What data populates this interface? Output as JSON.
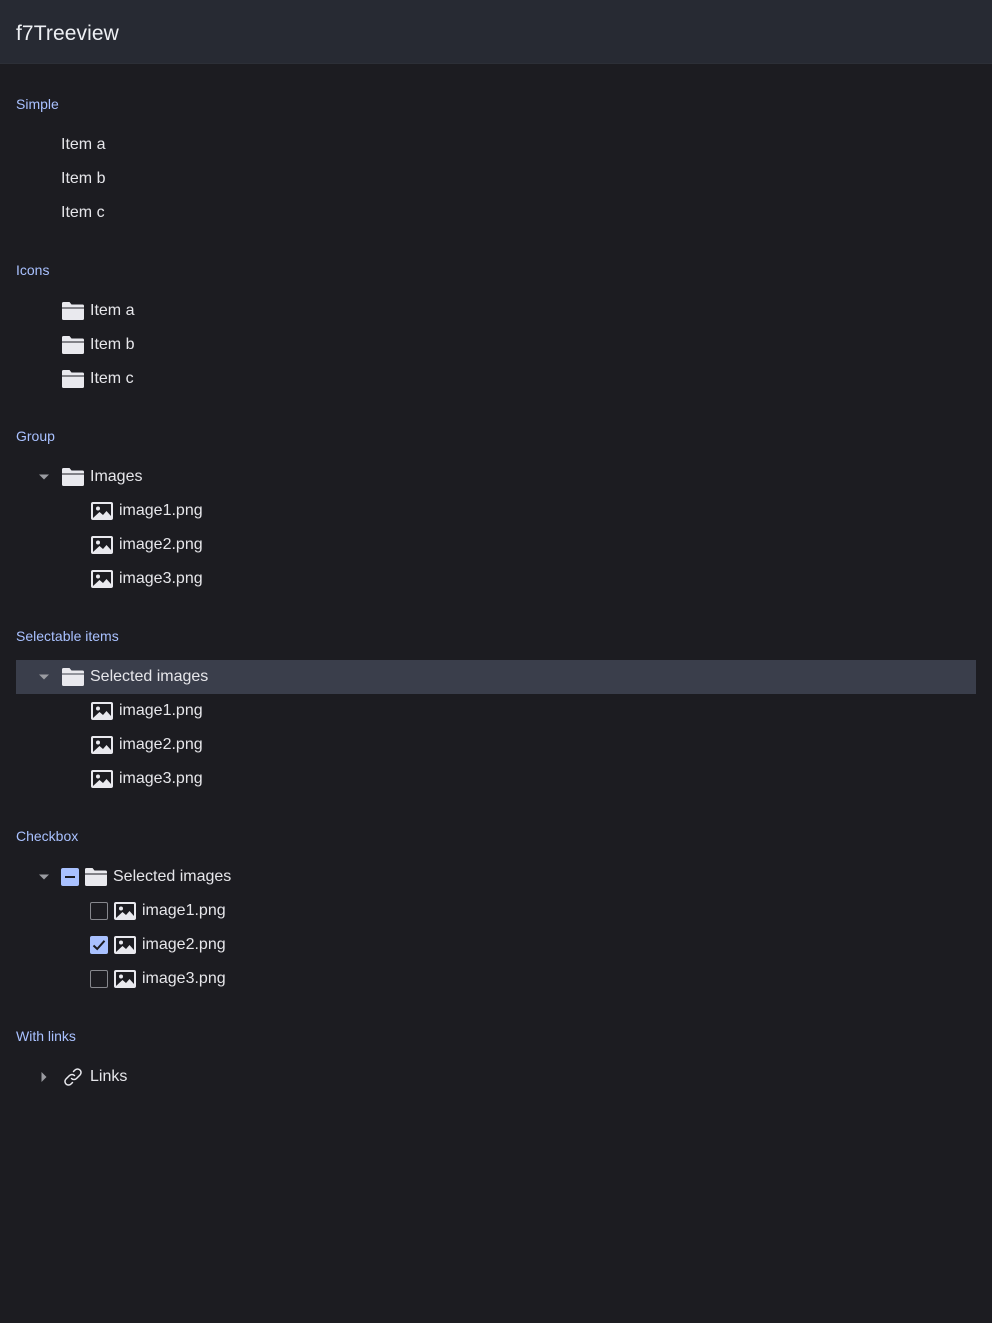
{
  "navbar": {
    "title": "f7Treeview"
  },
  "sections": {
    "simple": {
      "title": "Simple",
      "items": [
        "Item a",
        "Item b",
        "Item c"
      ]
    },
    "icons": {
      "title": "Icons",
      "items": [
        "Item a",
        "Item b",
        "Item c"
      ],
      "icon": "folder-icon"
    },
    "group": {
      "title": "Group",
      "parent": "Images",
      "children": [
        "image1.png",
        "image2.png",
        "image3.png"
      ],
      "expanded": true
    },
    "selectable": {
      "title": "Selectable items",
      "parent": "Selected images",
      "parent_selected": true,
      "children": [
        "image1.png",
        "image2.png",
        "image3.png"
      ]
    },
    "checkbox": {
      "title": "Checkbox",
      "parent": "Selected images",
      "parent_state": "indeterminate",
      "children": [
        {
          "label": "image1.png",
          "checked": false
        },
        {
          "label": "image2.png",
          "checked": true
        },
        {
          "label": "image3.png",
          "checked": false
        }
      ]
    },
    "links": {
      "title": "With links",
      "parent": "Links",
      "expanded": false,
      "icon": "link-icon"
    }
  },
  "colors": {
    "background": "#1c1c21",
    "navbar": "#272a33",
    "accent": "#a9c1ff",
    "selected_row": "#3a3e4b",
    "text": "#e6e6ea"
  }
}
